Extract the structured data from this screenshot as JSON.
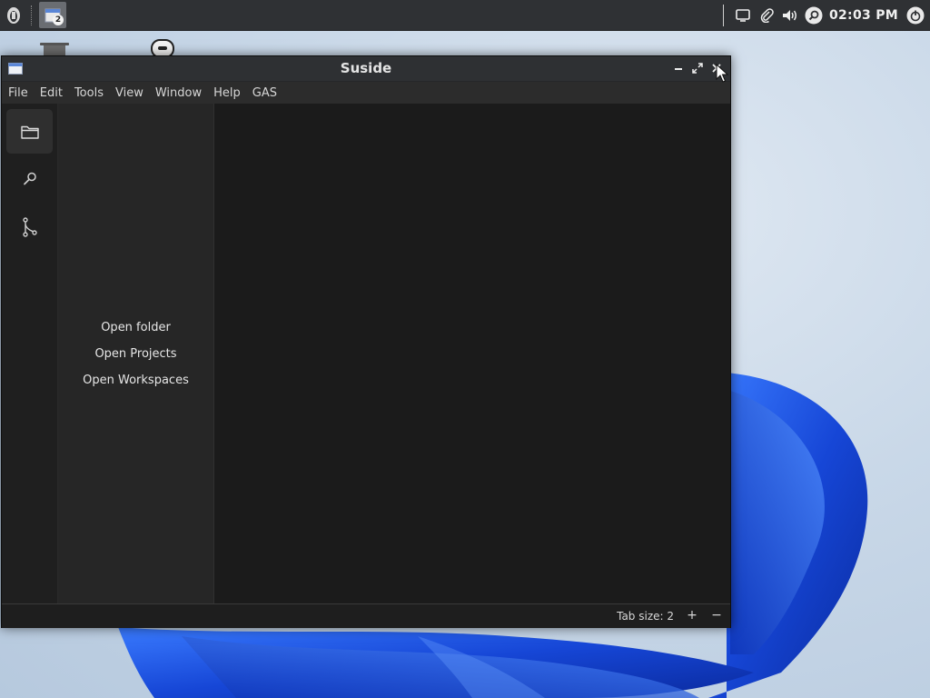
{
  "panel": {
    "task_count": "2",
    "clock": "02:03 PM",
    "launcher_icon": "launcher-icon",
    "tray_icons": [
      "screen-icon",
      "paperclip-icon",
      "volume-icon",
      "search-icon",
      "power-icon"
    ]
  },
  "window": {
    "title": "Suside",
    "menu": [
      "File",
      "Edit",
      "Tools",
      "View",
      "Window",
      "Help",
      "GAS"
    ],
    "activity": [
      "folder-icon",
      "search-icon",
      "source-control-icon"
    ],
    "sidebar": {
      "open_folder": "Open folder",
      "open_projects": "Open Projects",
      "open_workspaces": "Open Workspaces"
    },
    "status": {
      "tab_size": "Tab size: 2",
      "increase": "+",
      "decrease": "−"
    }
  },
  "colors": {
    "panel_bg": "#2f3134",
    "window_bg": "#1b1b1b",
    "sidebar_bg": "#262626",
    "accent_blue": "#1f57d6"
  }
}
